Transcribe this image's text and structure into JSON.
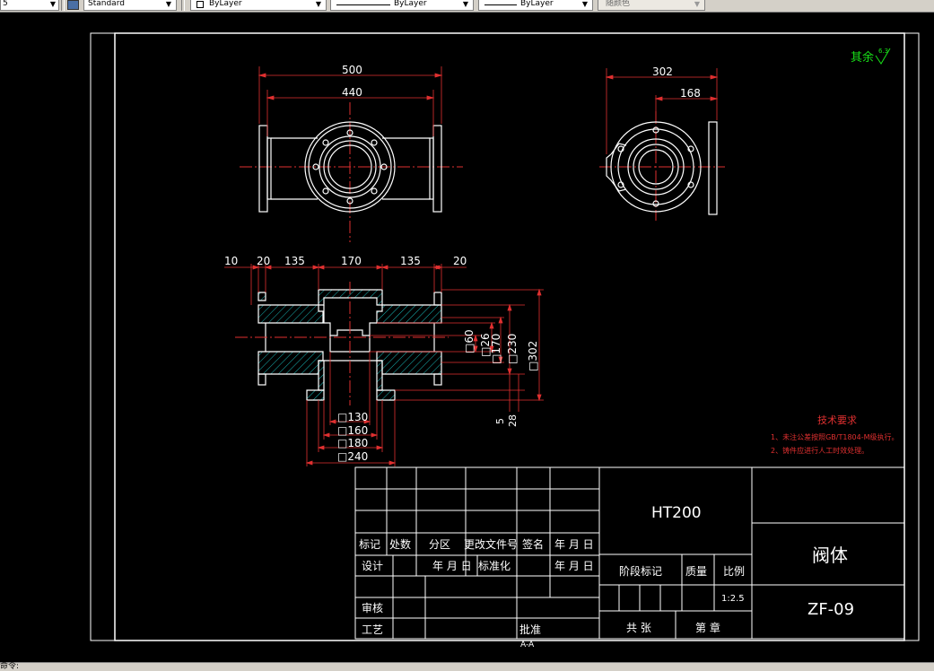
{
  "toolbar": {
    "layer_index": "5",
    "text_style": "Standard",
    "layer": "ByLayer",
    "linetype": "ByLayer",
    "lineweight": "ByLayer",
    "color": "随颜色"
  },
  "status": {
    "command_prompt": "命令:"
  },
  "drawing": {
    "surface_note": "其余",
    "roughness_value": "6.3",
    "front_view": {
      "dims": [
        "500",
        "440"
      ]
    },
    "side_view": {
      "dims": [
        "302",
        "168"
      ]
    },
    "section_view": {
      "top_dims": [
        "10",
        "20",
        "135",
        "170",
        "135",
        "20"
      ],
      "right_dims": [
        "□60",
        "□26",
        "□170",
        "□230",
        "□302"
      ],
      "small_dims": [
        "5",
        "28"
      ],
      "bottom_dims": [
        "□130",
        "□160",
        "□180",
        "□240"
      ],
      "label": "A-A"
    },
    "tech": {
      "title": "技术要求",
      "items": [
        "1、未注公差按照GB/T1804-M级执行。",
        "2、铸件应进行人工时效处理。"
      ]
    },
    "title_block": {
      "material": "HT200",
      "part_name": "阀体",
      "drawing_no": "ZF-09",
      "scale": "1:2.5",
      "labels": {
        "mark": "标记",
        "count": "处数",
        "zone": "分区",
        "change_doc": "更改文件号",
        "sign": "签名",
        "date": "年 月 日",
        "design": "设计",
        "standardize": "标准化",
        "review": "审核",
        "process": "工艺",
        "approve": "批准",
        "stage": "阶段标记",
        "weight": "质量",
        "scale_label": "比例",
        "total": "共  张",
        "sheet": "第  章"
      }
    }
  }
}
